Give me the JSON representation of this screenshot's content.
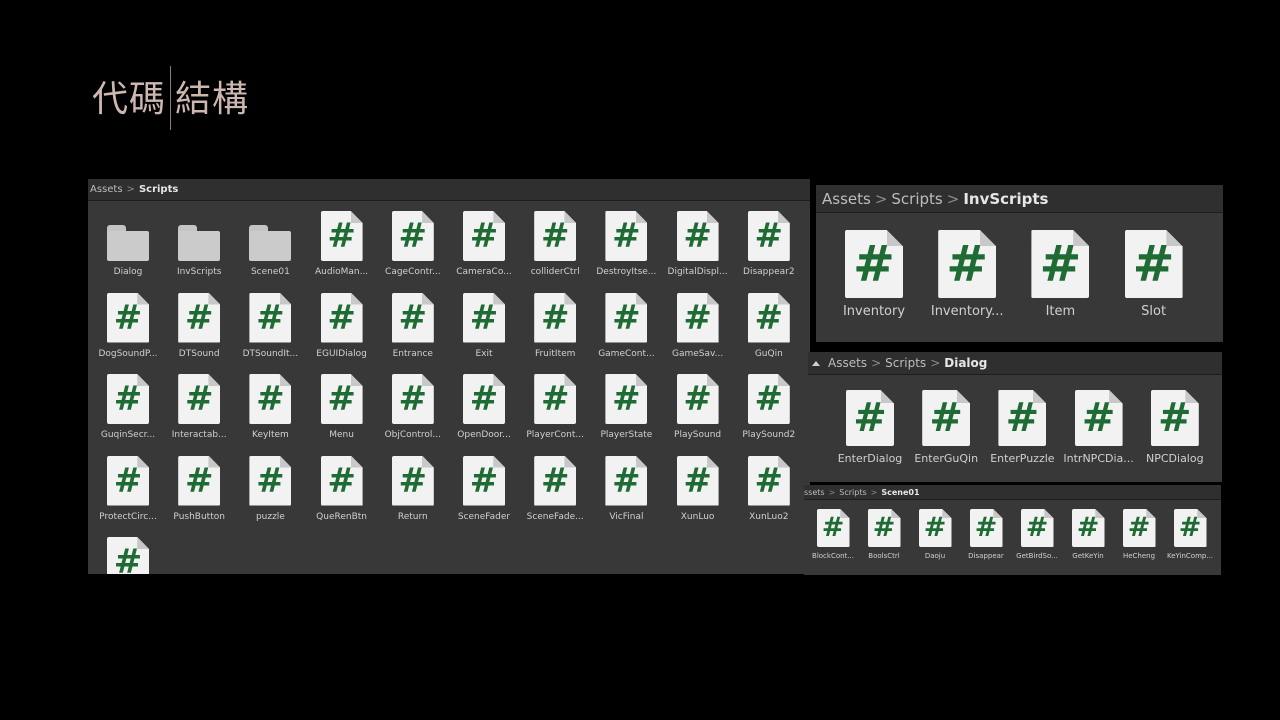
{
  "title": {
    "left": "代碼",
    "right": "結構"
  },
  "main_panel": {
    "breadcrumb": {
      "root": "Assets",
      "current": "Scripts"
    },
    "folders": [
      "Dialog",
      "InvScripts",
      "Scene01"
    ],
    "scripts": [
      "AudioMan...",
      "CageContr...",
      "CameraCo...",
      "colliderCtrl",
      "DestroyItse...",
      "DigitalDispl...",
      "Disappear2",
      "DogSoundP...",
      "DTSound",
      "DTSoundIt...",
      "EGUIDialog",
      "Entrance",
      "Exit",
      "FruitItem",
      "GameCont...",
      "GameSav...",
      "GuQin",
      "GuqinSecr...",
      "Interactab...",
      "KeyItem",
      "Menu",
      "ObjControl...",
      "OpenDoor...",
      "PlayerCont...",
      "PlayerState",
      "PlaySound",
      "PlaySound2",
      "ProtectCirc...",
      "PushButton",
      "puzzle",
      "QueRenBtn",
      "Return",
      "SceneFader",
      "SceneFade...",
      "VicFinal",
      "XunLuo",
      "XunLuo2",
      ""
    ]
  },
  "inv_panel": {
    "breadcrumb": {
      "root": "Assets",
      "mid": "Scripts",
      "current": "InvScripts"
    },
    "scripts": [
      "Inventory",
      "Inventory...",
      "Item",
      "Slot"
    ]
  },
  "dialog_panel": {
    "breadcrumb": {
      "root": "Assets",
      "mid": "Scripts",
      "current": "Dialog"
    },
    "scripts": [
      "EnterDialog",
      "EnterGuQin",
      "EnterPuzzle",
      "IntrNPCDia...",
      "NPCDialog"
    ]
  },
  "scene_panel": {
    "breadcrumb": {
      "root": "ssets",
      "mid": "Scripts",
      "current": "Scene01"
    },
    "scripts": [
      "BlockCont...",
      "BoolsCtrl",
      "Daoju",
      "Disappear",
      "GetBirdSo...",
      "GetKeYin",
      "HeCheng",
      "KeYinComp..."
    ]
  },
  "icons": {
    "script": "csharp-script-icon",
    "folder": "folder-icon",
    "hash_glyph": "#"
  },
  "colors": {
    "hash": "#1f6b34",
    "panel": "#383838",
    "background": "#000000"
  }
}
